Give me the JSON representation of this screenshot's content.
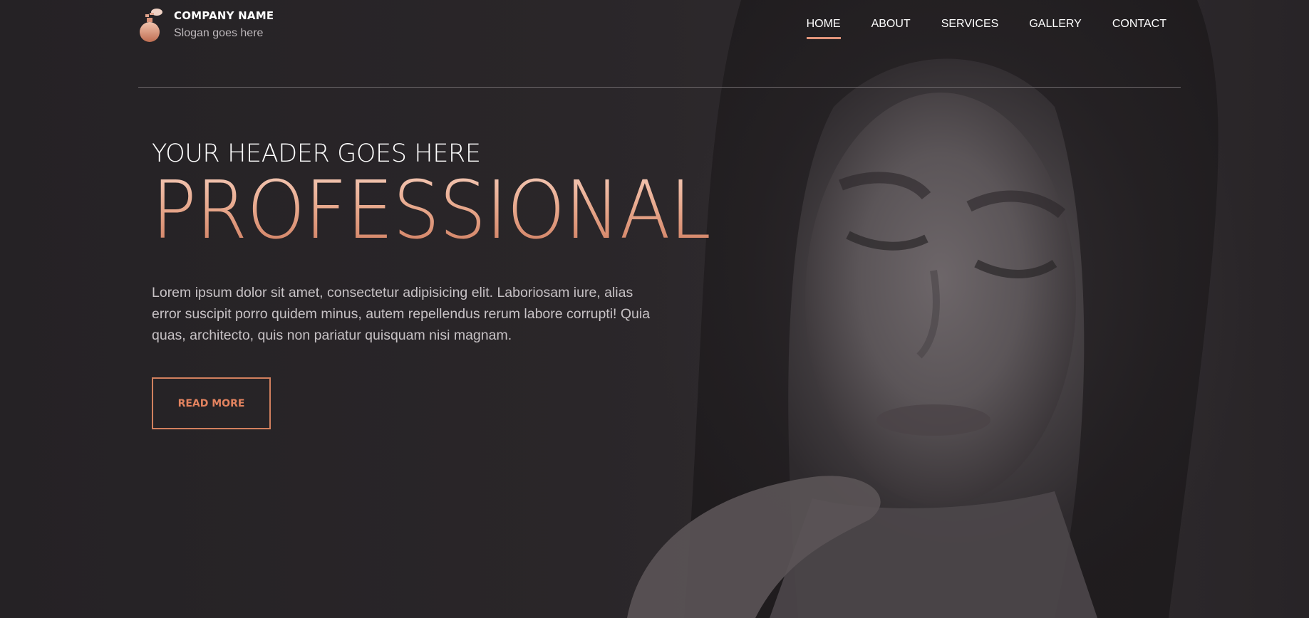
{
  "brand": {
    "name": "COMPANY NAME",
    "slogan": "Slogan goes here",
    "logo_icon": "perfume-bottle-icon"
  },
  "nav": {
    "items": [
      {
        "label": "HOME",
        "active": true
      },
      {
        "label": "ABOUT",
        "active": false
      },
      {
        "label": "SERVICES",
        "active": false
      },
      {
        "label": "GALLERY",
        "active": false
      },
      {
        "label": "CONTACT",
        "active": false
      }
    ]
  },
  "hero": {
    "subtitle": "YOUR HEADER GOES HERE",
    "title": "PROFESSIONAL",
    "body": "Lorem ipsum dolor sit amet, consectetur adipisicing elit. Laboriosam iure, alias error suscipit porro quidem minus, autem repellendus rerum labore corrupti! Quia quas, architecto, quis non pariatur quisquam nisi magnam.",
    "cta_label": "READ MORE"
  },
  "colors": {
    "background": "#262326",
    "accent": "#d2805e",
    "accent_light": "#f0bfa9",
    "text": "#ffffff",
    "muted_text": "#c7c2c5"
  }
}
